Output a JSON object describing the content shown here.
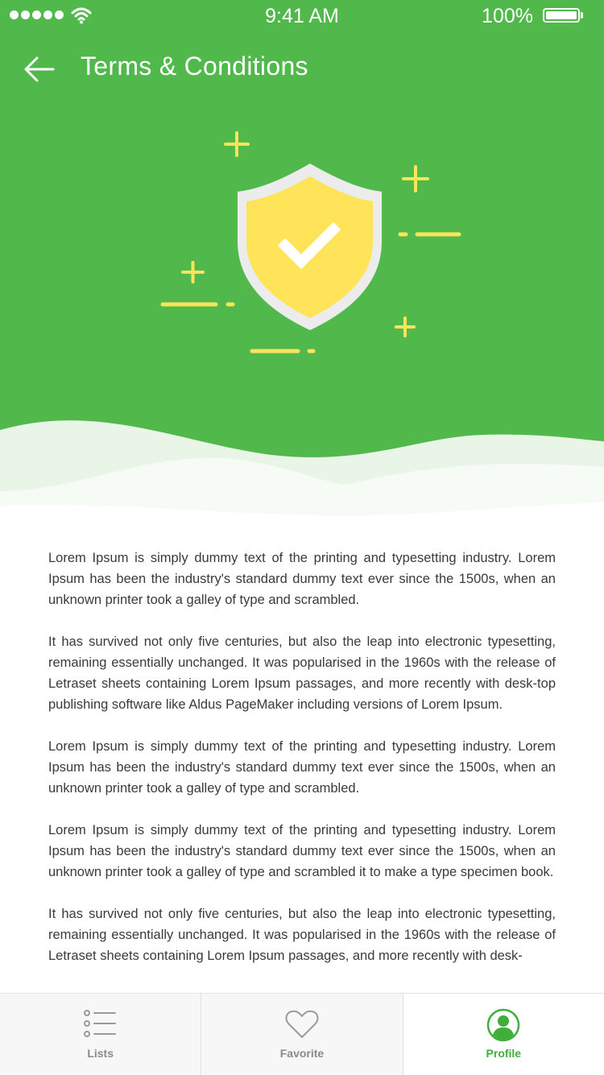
{
  "status_bar": {
    "time": "9:41 AM",
    "battery": "100%",
    "signal_icon": "signal-dots-icon",
    "wifi_icon": "wifi-icon",
    "battery_icon": "battery-icon"
  },
  "nav": {
    "back_icon": "arrow-left-icon",
    "title": "Terms & Conditions"
  },
  "illustration": {
    "icon": "shield-check-icon"
  },
  "content": {
    "paragraphs": [
      "Lorem Ipsum is simply dummy text of the printing and typesetting industry. Lorem Ipsum has been the industry's standard dummy text ever since the 1500s, when an unknown printer took a galley of type and scrambled.",
      "It has survived not only five centuries, but also the leap into electronic typesetting, remaining essentially unchanged. It was popularised in the 1960s with the release of Letraset sheets containing Lorem Ipsum passages, and more recently with desk-top publishing software like Aldus PageMaker including versions of Lorem Ipsum.",
      "Lorem Ipsum is simply dummy text of the printing and typesetting industry. Lorem Ipsum has been the industry's standard dummy text ever since the 1500s, when an unknown printer took a galley of type and scrambled.",
      "Lorem Ipsum is simply dummy text of the printing and typesetting industry. Lorem Ipsum has been the industry's standard dummy text ever since the 1500s, when an unknown printer took a galley of type and scrambled it to make a type specimen book.",
      "It has survived not only five centuries, but also the leap into electronic typesetting, remaining essentially unchanged. It was popularised in the 1960s with the release of Letraset sheets containing Lorem Ipsum passages, and more recently with desk-"
    ]
  },
  "tabs": [
    {
      "label": "Lists",
      "icon": "list-icon",
      "active": false
    },
    {
      "label": "Favorite",
      "icon": "heart-icon",
      "active": false
    },
    {
      "label": "Profile",
      "icon": "user-circle-icon",
      "active": true
    }
  ],
  "colors": {
    "header_green": "#51b94b",
    "accent_yellow": "#ffe45a",
    "shield_border": "#ececec",
    "active_tab": "#3fae3a",
    "inactive_tab": "#8a8a8a",
    "body_text": "#3a3a3a"
  }
}
